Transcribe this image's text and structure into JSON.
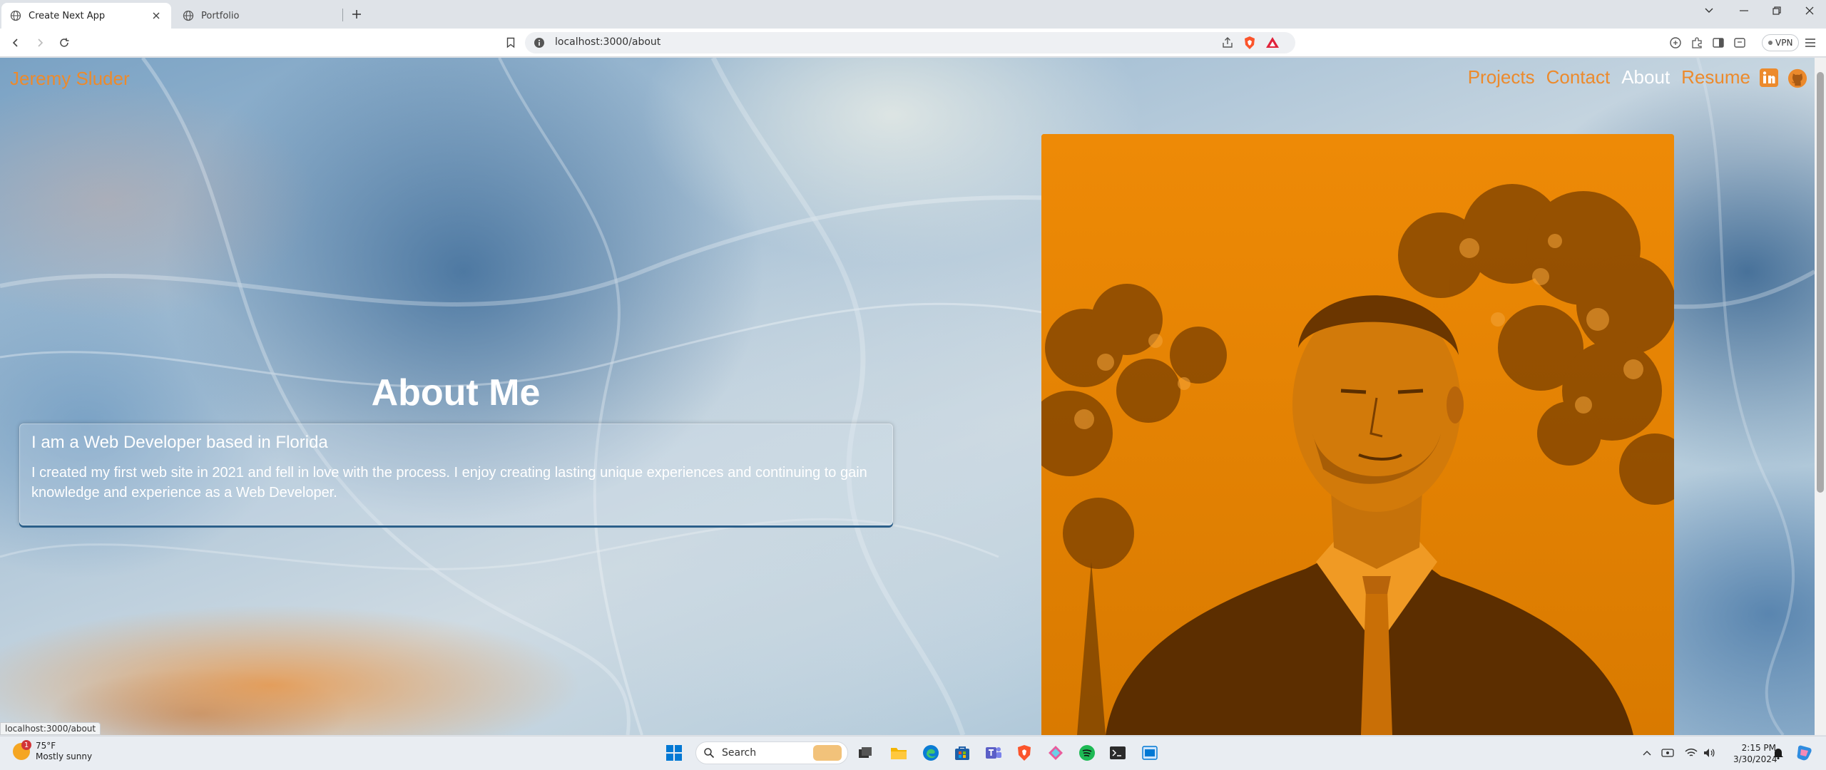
{
  "browser": {
    "tabs": [
      {
        "label": "Create Next App",
        "active": true
      },
      {
        "label": "Portfolio",
        "active": false
      }
    ],
    "url": "localhost:3000/about",
    "vpn_label": "VPN"
  },
  "site": {
    "logo": "Jeremy Sluder",
    "nav": [
      "Projects",
      "Contact",
      "About",
      "Resume"
    ],
    "current_page": "About",
    "accent_color": "#ec8a2c",
    "about_title": "About Me",
    "card_title": "I am a Web Developer based in Florida",
    "card_text": "I created my first web site in 2021 and fell in love with the process. I enjoy creating lasting unique experiences and continuing to gain knowledge and experience as a Web Developer.",
    "portrait_tint": "#e98200",
    "social_icons": [
      "linkedin-icon",
      "github-icon"
    ]
  },
  "status_bar_url": "localhost:3000/about",
  "taskbar": {
    "weather_temp": "75°F",
    "weather_desc": "Mostly sunny",
    "weather_badge": "1",
    "search_label": "Search",
    "time": "2:15 PM",
    "date": "3/30/2024"
  }
}
